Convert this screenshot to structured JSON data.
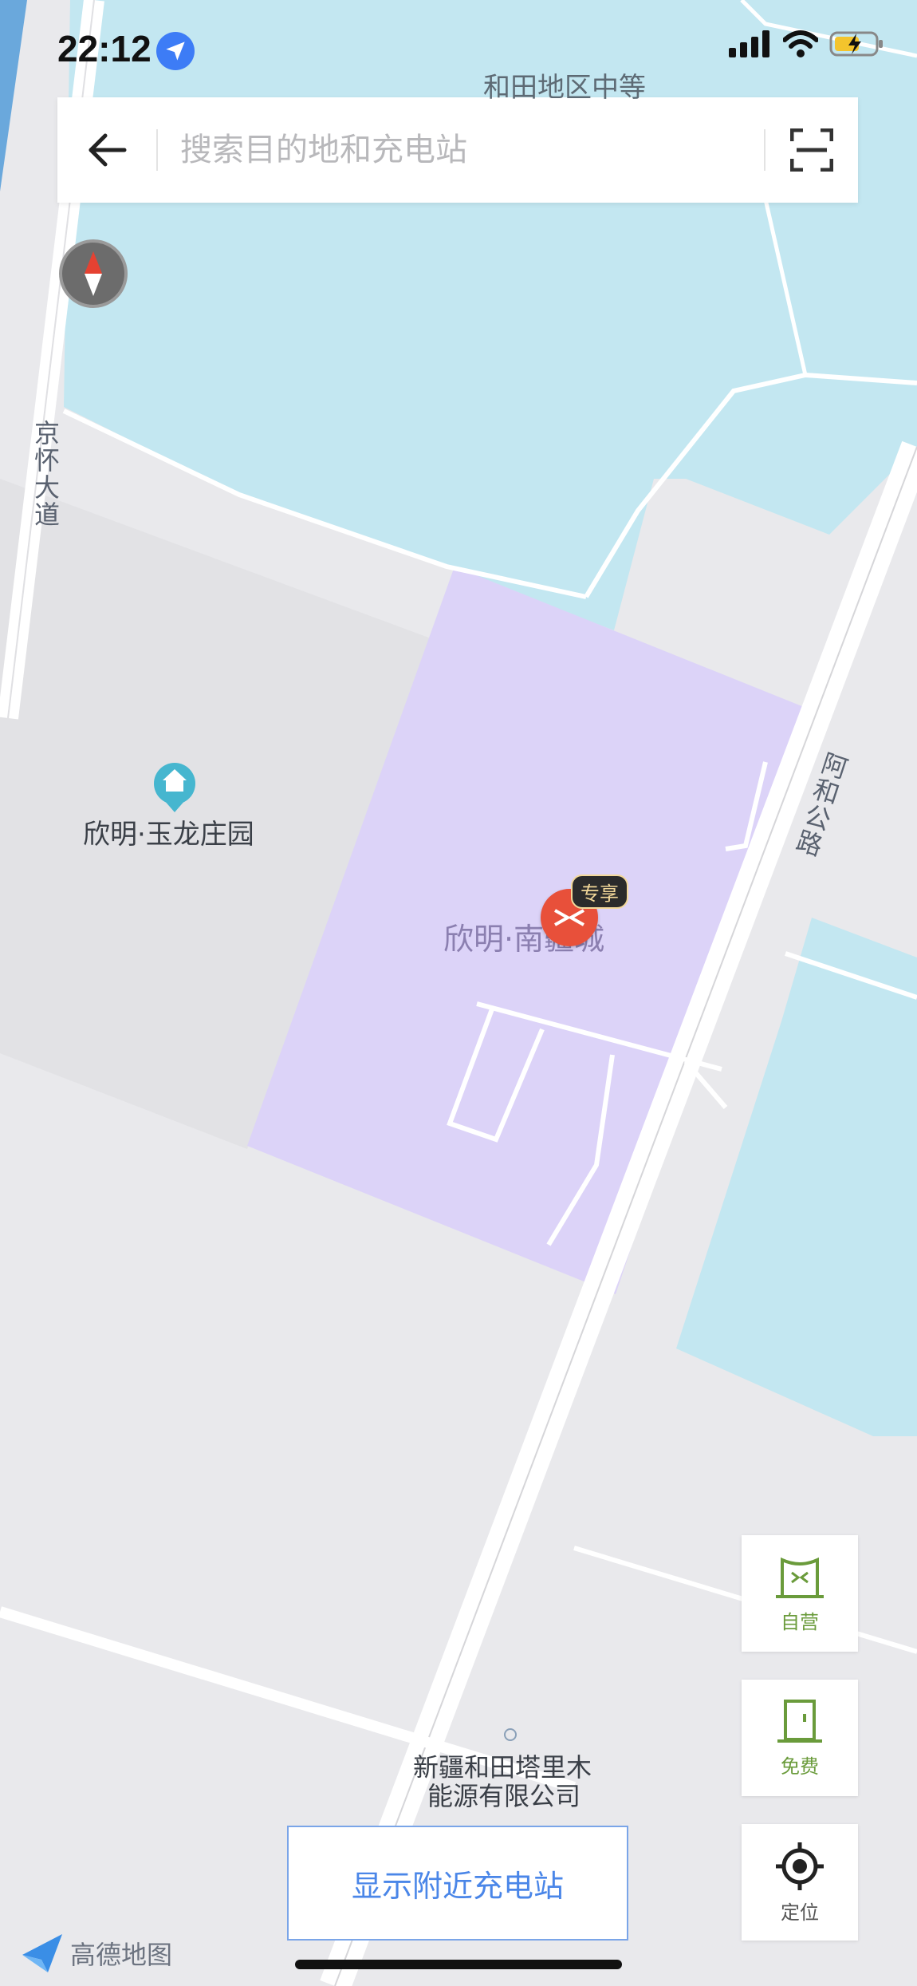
{
  "status_bar": {
    "time": "22:12",
    "location_icon": "location-arrow-icon",
    "signal_icon": "cellular-signal-icon",
    "wifi_icon": "wifi-icon",
    "battery_icon": "battery-charging-icon"
  },
  "search": {
    "placeholder": "搜索目的地和充电站",
    "back_icon": "arrow-left-icon",
    "scan_icon": "scan-icon"
  },
  "map": {
    "top_label": "和田地区中等",
    "road_jinghuai": "京怀大道",
    "road_ahe": "阿和公路",
    "poi_yulong": "欣明·玉龙庄园",
    "poi_nanjiang": "欣明·南疆城",
    "poi_company_line1": "新疆和田塔里木",
    "poi_company_line2": "能源有限公司",
    "marker_badge": "专享",
    "colors": {
      "background": "#e9e9ec",
      "water": "#c3e7f1",
      "area": "#dcd3f8",
      "block": "#e2e2e5",
      "marker": "#e8503a"
    }
  },
  "side_buttons": [
    {
      "label": "自营",
      "icon": "self-operated-icon",
      "color": "#6a9b3b"
    },
    {
      "label": "免费",
      "icon": "door-icon",
      "color": "#6a9b3b"
    },
    {
      "label": "定位",
      "icon": "locate-icon",
      "color": "#555555"
    }
  ],
  "nearby_button": {
    "label": "显示附近充电站"
  },
  "logo": {
    "text": "高德地图",
    "icon": "amap-logo-icon"
  }
}
